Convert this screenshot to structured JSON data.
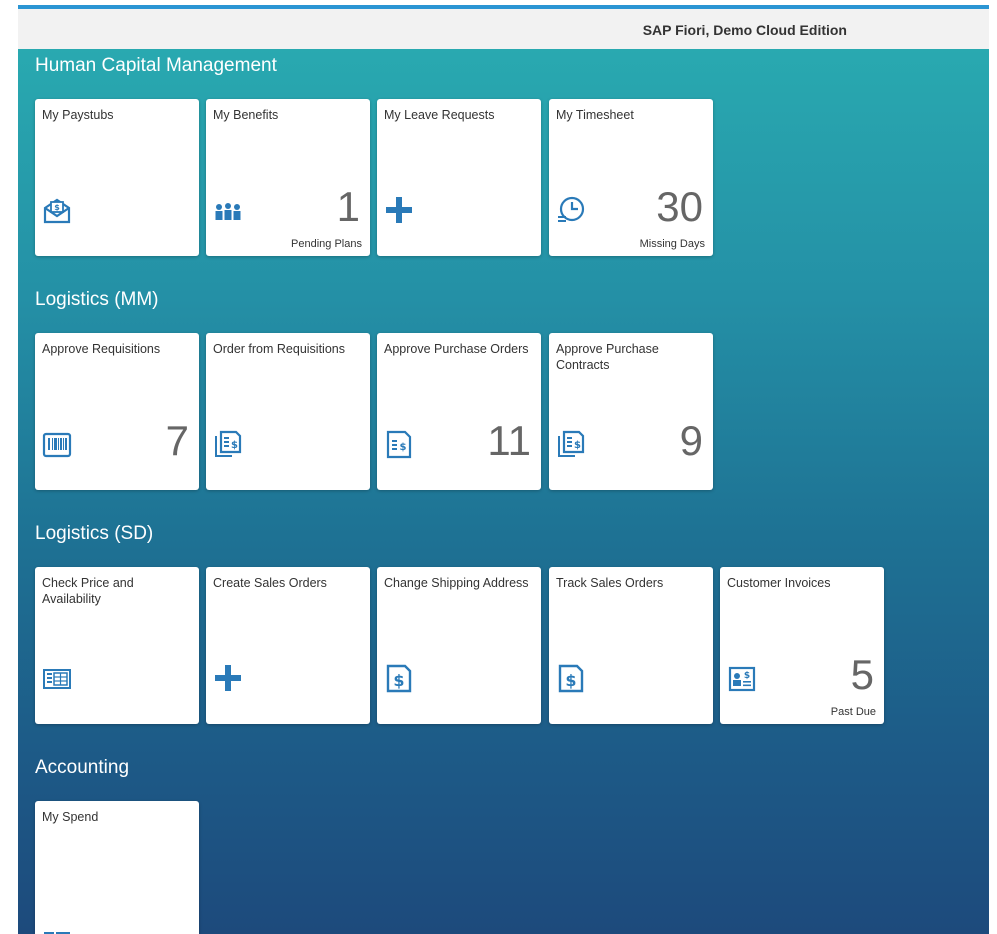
{
  "header": {
    "title": "SAP Fiori, Demo Cloud Edition"
  },
  "groups": [
    {
      "title": "Human Capital Management",
      "tiles": [
        {
          "title": "My Paystubs",
          "icon": "paystub-envelope-icon",
          "number": "",
          "footer": ""
        },
        {
          "title": "My Benefits",
          "icon": "people-group-icon",
          "number": "1",
          "footer": "Pending Plans"
        },
        {
          "title": "My Leave Requests",
          "icon": "add-plus-icon",
          "number": "",
          "footer": ""
        },
        {
          "title": "My Timesheet",
          "icon": "clock-timesheet-icon",
          "number": "30",
          "footer": "Missing Days"
        }
      ]
    },
    {
      "title": "Logistics (MM)",
      "tiles": [
        {
          "title": "Approve Requisitions",
          "icon": "barcode-document-icon",
          "number": "7",
          "footer": ""
        },
        {
          "title": "Order from Requisitions",
          "icon": "documents-dollar-icon",
          "number": "",
          "footer": ""
        },
        {
          "title": "Approve Purchase Orders",
          "icon": "document-dollar-icon",
          "number": "11",
          "footer": ""
        },
        {
          "title": "Approve Purchase Contracts",
          "icon": "documents-dollar-icon",
          "number": "9",
          "footer": ""
        }
      ]
    },
    {
      "title": "Logistics (SD)",
      "tiles": [
        {
          "title": "Check Price and Availability",
          "icon": "price-list-icon",
          "number": "",
          "footer": ""
        },
        {
          "title": "Create Sales Orders",
          "icon": "add-plus-icon",
          "number": "",
          "footer": ""
        },
        {
          "title": "Change Shipping Address",
          "icon": "dollar-document-icon",
          "number": "",
          "footer": ""
        },
        {
          "title": "Track Sales Orders",
          "icon": "dollar-document-icon",
          "number": "",
          "footer": ""
        },
        {
          "title": "Customer Invoices",
          "icon": "customer-invoice-icon",
          "number": "5",
          "footer": "Past Due"
        }
      ]
    },
    {
      "title": "Accounting",
      "tiles": [
        {
          "title": "My Spend",
          "icon": "spend-tiles-icon",
          "number": "",
          "footer": ""
        }
      ]
    }
  ],
  "colors": {
    "accent": "#2b95d3",
    "icon": "#2a7ab8",
    "number": "#666666"
  }
}
